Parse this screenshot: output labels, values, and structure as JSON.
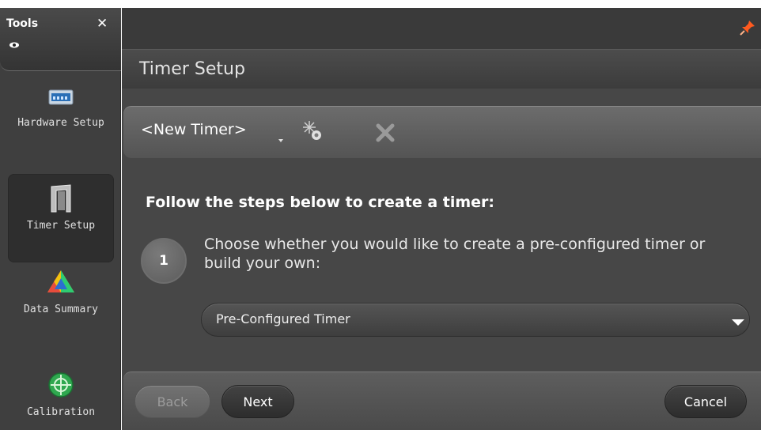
{
  "tools_panel": {
    "title": "Tools",
    "close_glyph": "✕",
    "items": [
      {
        "label": "Hardware Setup",
        "icon": "hardware-icon",
        "active": false
      },
      {
        "label": "Timer Setup",
        "icon": "timer-icon",
        "active": true
      },
      {
        "label": "Data Summary",
        "icon": "data-summary-icon",
        "active": false
      },
      {
        "label": "Calibration",
        "icon": "calibration-icon",
        "active": false
      }
    ]
  },
  "header": {
    "title": "Timer Setup",
    "pin_icon": "pin-icon"
  },
  "timer_bar": {
    "selected_timer": "<New Timer>",
    "new_icon": "new-timer-icon",
    "delete_icon": "delete-icon"
  },
  "content": {
    "heading": "Follow the steps below to create a timer:",
    "step": {
      "number": "1",
      "text": "Choose whether you would like to create a pre-configured timer or build your own:"
    },
    "dropdown": {
      "value": "Pre-Configured Timer"
    }
  },
  "footer": {
    "back_label": "Back",
    "next_label": "Next",
    "cancel_label": "Cancel",
    "back_enabled": false
  },
  "colors": {
    "panel_dark": "#3f3f3f",
    "main_bg": "#474747",
    "pin_accent": "#ff5a1f",
    "calibration_green": "#2fa84f"
  }
}
